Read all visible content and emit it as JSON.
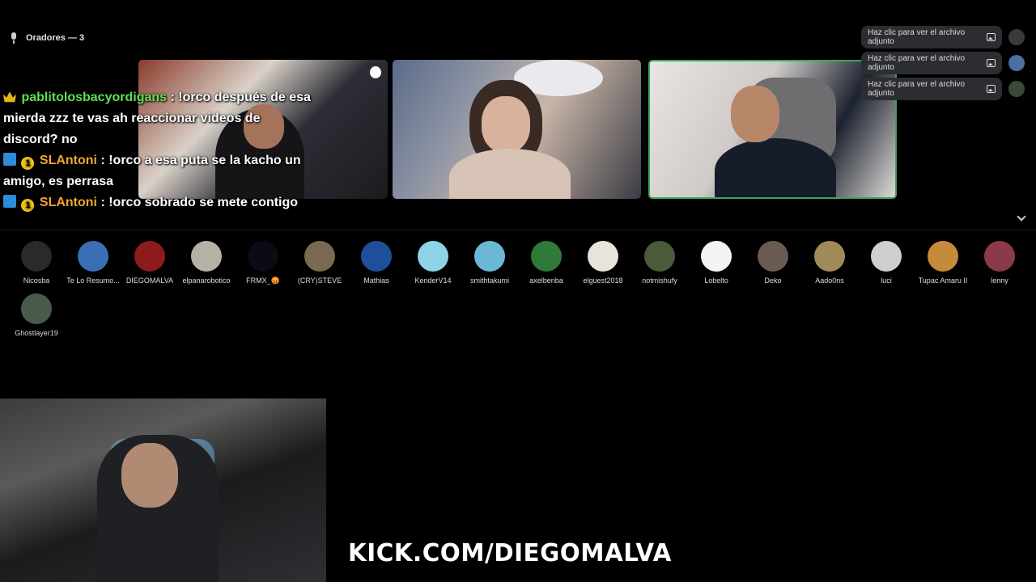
{
  "speakers": {
    "title": "Oradores — 3"
  },
  "chat": [
    {
      "badges": [
        "crown"
      ],
      "user": "pablitolosbacyordigans",
      "user_color": "#5ee052",
      "message": ": !orco después de esa mierda zzz te vas ah reaccionar videos de discord? no"
    },
    {
      "badges": [
        "prime",
        "coin"
      ],
      "user": "SLAntoni",
      "user_color": "#f2a531",
      "message": ": !orco a esa puta se la kacho un amigo, es perrasa"
    },
    {
      "badges": [
        "prime",
        "coin"
      ],
      "user": "SLAntoni",
      "user_color": "#f2a531",
      "message": ": !orco sobrado se mete contigo"
    }
  ],
  "notifications": [
    {
      "text": "Haz clic para ver el archivo adjunto",
      "icon": "image-icon"
    },
    {
      "text": "Haz clic para ver el archivo adjunto",
      "icon": "image-icon"
    },
    {
      "text": "Haz clic para ver el archivo adjunto",
      "icon": "image-icon"
    }
  ],
  "audience": [
    {
      "name": "Nicosba",
      "color": "#2a2a2a"
    },
    {
      "name": "Te Lo Resumo...",
      "color": "#3b6fb5"
    },
    {
      "name": "DIEGOMALVA",
      "color": "#8e1b1b"
    },
    {
      "name": "elpanarobotico",
      "color": "#b7b0a6"
    },
    {
      "name": "FRMX_😡",
      "color": "#0b0b14"
    },
    {
      "name": "(CRY)STEVE",
      "color": "#7a6a52"
    },
    {
      "name": "Mathias",
      "color": "#1f4f9b"
    },
    {
      "name": "KenderV14",
      "color": "#8fd3e8"
    },
    {
      "name": "smithtakumi",
      "color": "#6bb8d6"
    },
    {
      "name": "axelbenba",
      "color": "#2f7a3a"
    },
    {
      "name": "elguest2018",
      "color": "#e8e4dc"
    },
    {
      "name": "notmishufy",
      "color": "#4a5a3a"
    },
    {
      "name": "Lobelto",
      "color": "#f3f3f3"
    },
    {
      "name": "Deko",
      "color": "#6b5a52"
    },
    {
      "name": "Aado0ns",
      "color": "#a08a5a"
    },
    {
      "name": "luci",
      "color": "#cfcfcf"
    },
    {
      "name": "Tupac Amaru II",
      "color": "#c58a3a"
    },
    {
      "name": "lenny",
      "color": "#8a3a4a"
    },
    {
      "name": "Ghostlayer19",
      "color": "#4a5a4a"
    }
  ],
  "overlay": {
    "url": "KICK.COM/DIEGOMALVA"
  }
}
